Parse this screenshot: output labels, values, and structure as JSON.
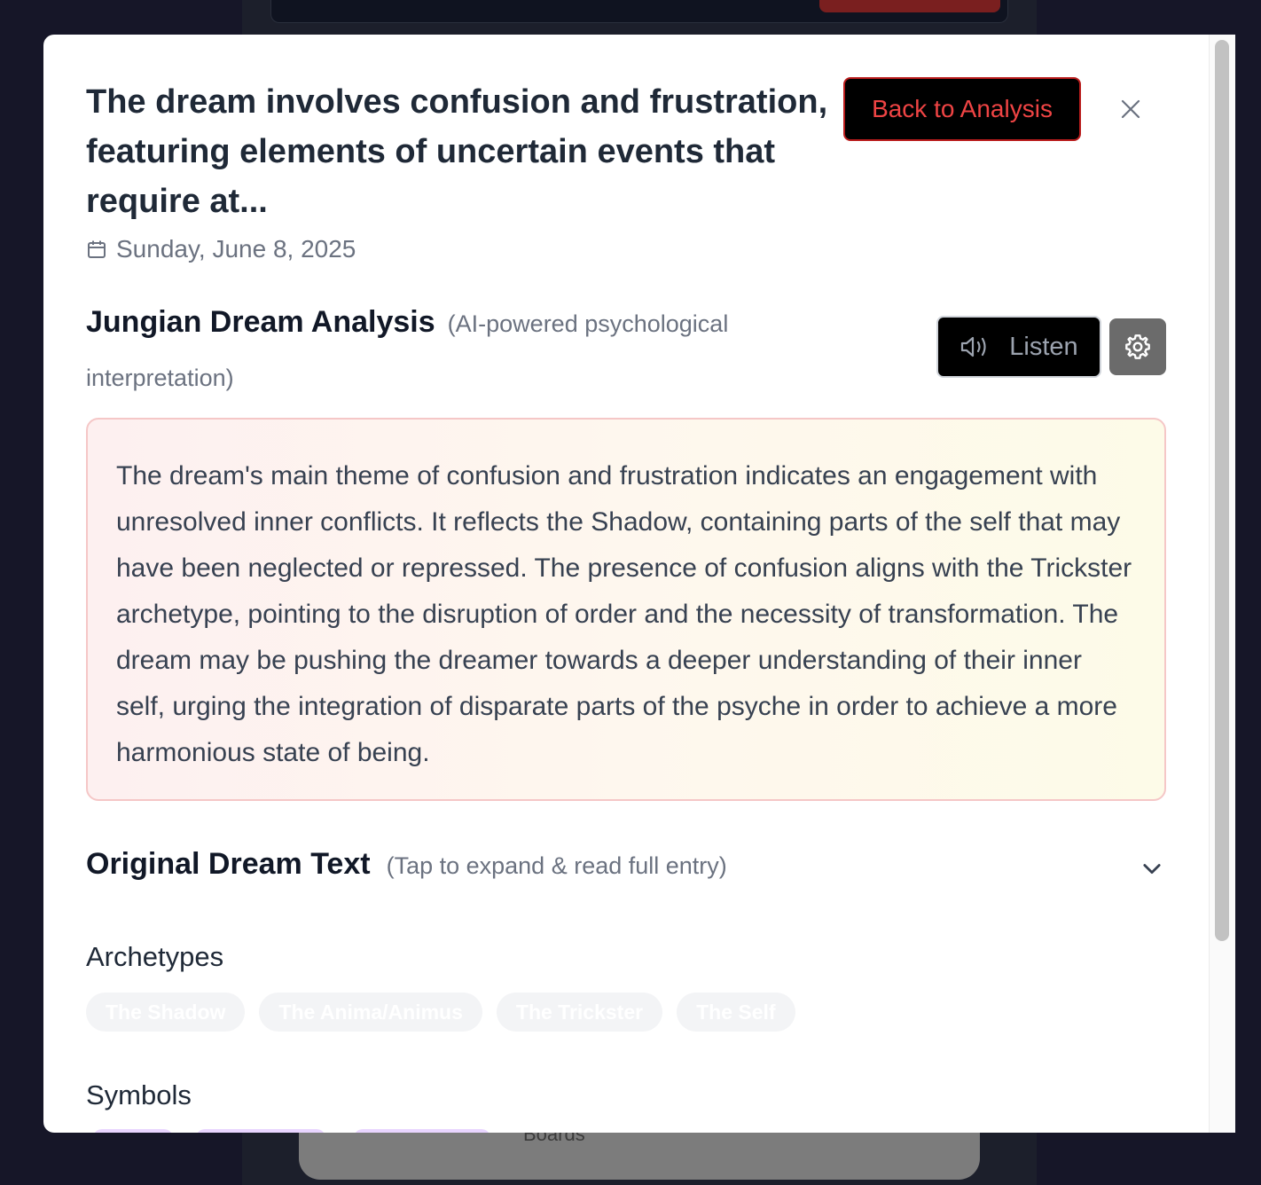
{
  "background": {
    "bottom_nav_label": "Boards"
  },
  "modal": {
    "title": "The dream involves confusion and frustration, featuring elements of uncertain events that require at...",
    "back_button_label": "Back to Analysis",
    "close_icon": "close-icon",
    "date": "Sunday, June 8, 2025",
    "analysis": {
      "heading": "Jungian Dream Analysis",
      "subheading": "(AI-powered psychological interpretation)",
      "listen_label": "Listen",
      "body": "The dream's main theme of confusion and frustration indicates an engagement with unresolved inner conflicts. It reflects the Shadow, containing parts of the self that may have been neglected or repressed. The presence of confusion aligns with the Trickster archetype, pointing to the disruption of order and the necessity of transformation. The dream may be pushing the dreamer towards a deeper understanding of their inner self, urging the integration of disparate parts of the psyche in order to achieve a more harmonious state of being."
    },
    "original": {
      "heading": "Original Dream Text",
      "subheading": "(Tap to expand & read full entry)"
    },
    "archetypes": {
      "label": "Archetypes",
      "items": [
        "The Shadow",
        "The Anima/Animus",
        "The Trickster",
        "The Self"
      ]
    },
    "symbols": {
      "label": "Symbols"
    }
  },
  "colors": {
    "accent_red": "#ef4444",
    "card_border": "#f5c7c7"
  }
}
